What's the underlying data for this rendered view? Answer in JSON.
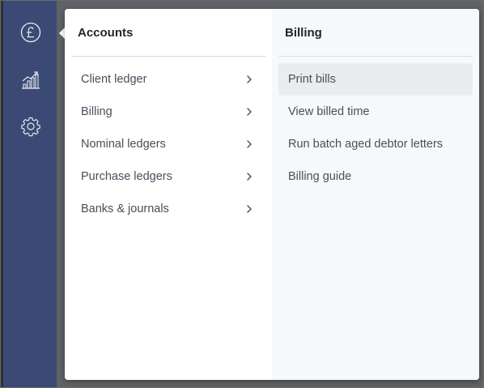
{
  "rail": {
    "icons": [
      {
        "name": "pound-currency-icon"
      },
      {
        "name": "growth-chart-icon"
      },
      {
        "name": "settings-gear-icon"
      }
    ]
  },
  "accounts": {
    "title": "Accounts",
    "items": [
      {
        "label": "Client ledger"
      },
      {
        "label": "Billing"
      },
      {
        "label": "Nominal ledgers"
      },
      {
        "label": "Purchase ledgers"
      },
      {
        "label": "Banks & journals"
      }
    ]
  },
  "billing": {
    "title": "Billing",
    "items": [
      {
        "label": "Print bills",
        "highlighted": true
      },
      {
        "label": "View billed time"
      },
      {
        "label": "Run batch aged debtor letters"
      },
      {
        "label": "Billing guide"
      }
    ]
  },
  "colors": {
    "rail": "#3b4a74",
    "panel": "#ffffff",
    "submenu": "#f7f8fa",
    "highlight": "#ebecef",
    "text": "#4a4e5a",
    "title": "#22252e"
  }
}
